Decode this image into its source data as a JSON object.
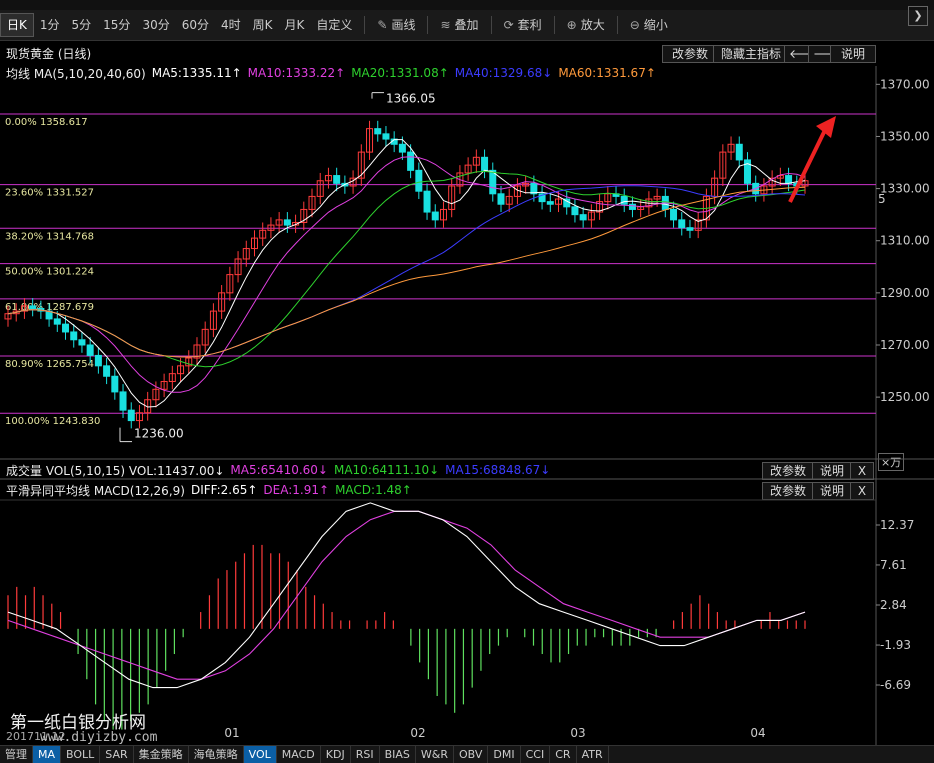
{
  "toolbar": {
    "items": [
      {
        "label": "日K",
        "active": true
      },
      {
        "label": "1分"
      },
      {
        "label": "5分"
      },
      {
        "label": "15分"
      },
      {
        "label": "30分"
      },
      {
        "label": "60分"
      },
      {
        "label": "4时"
      },
      {
        "label": "周K"
      },
      {
        "label": "月K"
      },
      {
        "label": "自定义"
      }
    ],
    "tools": [
      {
        "label": "画线",
        "icon": "pencil-icon"
      },
      {
        "label": "叠加",
        "icon": "layers-icon"
      },
      {
        "label": "套利",
        "icon": "arbitrage-icon"
      },
      {
        "label": "放大",
        "icon": "zoom-in-icon"
      },
      {
        "label": "缩小",
        "icon": "zoom-out-icon"
      }
    ],
    "right_icon": "chevron-right-icon"
  },
  "main": {
    "title": "现货黄金 (日线)",
    "buttons": [
      "改参数",
      "隐藏主指标"
    ],
    "help": "说明",
    "ma_line": {
      "label": "均线 MA(5,10,20,40,60)",
      "items": [
        {
          "text": "MA5:1335.11↑",
          "color": "#ffffff"
        },
        {
          "text": "MA10:1333.22↑",
          "color": "#e040e0"
        },
        {
          "text": "MA20:1331.08↑",
          "color": "#2ed12e"
        },
        {
          "text": "MA40:1329.68↓",
          "color": "#3c3cff"
        },
        {
          "text": "MA60:1331.67↑",
          "color": "#ff9a3c"
        }
      ]
    },
    "fib_levels": [
      {
        "label": "0.00% 1358.617",
        "value": 1358.617
      },
      {
        "label": "23.60% 1331.527",
        "value": 1331.527
      },
      {
        "label": "38.20% 1314.768",
        "value": 1314.768
      },
      {
        "label": "50.00% 1301.224",
        "value": 1301.224
      },
      {
        "label": "61.80% 1287.679",
        "value": 1287.679
      },
      {
        "label": "80.90% 1265.754",
        "value": 1265.754
      },
      {
        "label": "100.00% 1243.830",
        "value": 1243.83
      }
    ],
    "high_label": "1366.05",
    "low_label": "1236.00",
    "y_ticks": [
      "1370.00",
      "1350.00",
      "1330.00",
      "1310.00",
      "1290.00",
      "1270.00",
      "1250.00"
    ],
    "y_ticks_values": [
      1370,
      1350,
      1330,
      1310,
      1290,
      1270,
      1250
    ],
    "y_partial": "5"
  },
  "volume": {
    "label": "成交量 VOL(5,10,15) VOL:11437.00↓",
    "items": [
      {
        "text": "MA5:65410.60↓",
        "color": "#e040e0"
      },
      {
        "text": "MA10:64111.10↓",
        "color": "#2ed12e"
      },
      {
        "text": "MA15:68848.67↓",
        "color": "#3c3cff"
      }
    ],
    "buttons": [
      "改参数",
      "说明",
      "X"
    ],
    "unit": "×万"
  },
  "macd": {
    "label": "平滑异同平均线 MACD(12,26,9)",
    "items": [
      {
        "text": "DIFF:2.65↑",
        "color": "#ffffff"
      },
      {
        "text": "DEA:1.91↑",
        "color": "#e040e0"
      },
      {
        "text": "MACD:1.48↑",
        "color": "#2ed12e"
      }
    ],
    "buttons": [
      "改参数",
      "说明",
      "X"
    ],
    "y_ticks": [
      "12.37",
      "7.61",
      "2.84",
      "-1.93",
      "-6.69"
    ],
    "y_ticks_values": [
      12.37,
      7.61,
      2.84,
      -1.93,
      -6.69
    ]
  },
  "x_labels": [
    "01",
    "02",
    "03",
    "04"
  ],
  "date_label": "201711  12",
  "watermark": "第一纸白银分析网",
  "watermark_url": "www.diyizby.com",
  "bottom_tabs": [
    {
      "label": "管理"
    },
    {
      "label": "MA",
      "on": true
    },
    {
      "label": "BOLL"
    },
    {
      "label": "SAR"
    },
    {
      "label": "集金策略"
    },
    {
      "label": "海龟策略"
    },
    {
      "label": "VOL",
      "on": true
    },
    {
      "label": "MACD"
    },
    {
      "label": "KDJ"
    },
    {
      "label": "RSI"
    },
    {
      "label": "BIAS"
    },
    {
      "label": "W&R"
    },
    {
      "label": "OBV"
    },
    {
      "label": "DMI"
    },
    {
      "label": "CCI"
    },
    {
      "label": "CR"
    },
    {
      "label": "ATR"
    }
  ],
  "colors": {
    "up": "#ff3b3b",
    "down": "#19e0e0",
    "fib": "#cc33cc",
    "accent": "#0b5fa5"
  }
}
